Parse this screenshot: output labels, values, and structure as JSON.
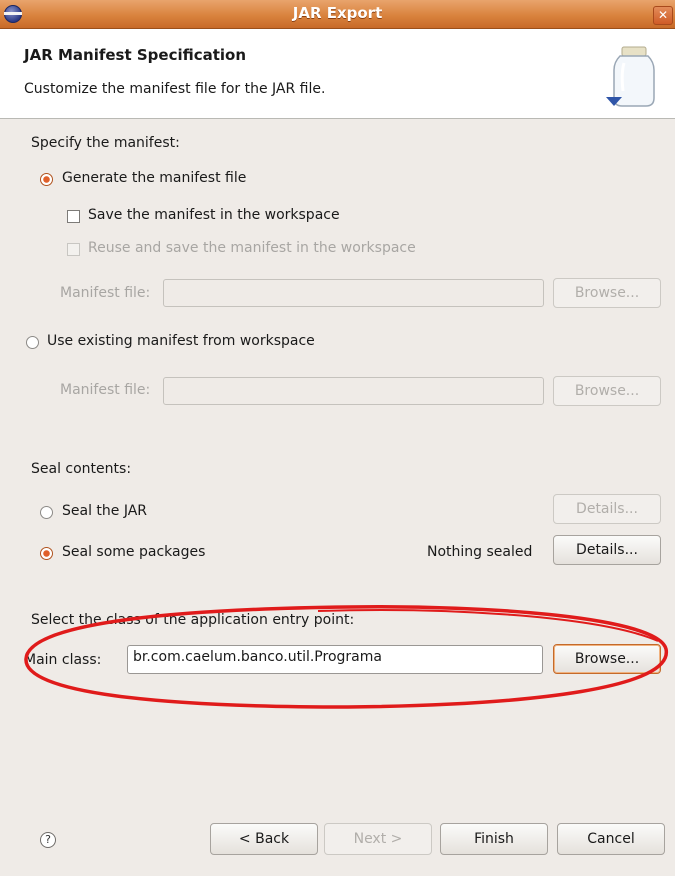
{
  "window": {
    "title": "JAR Export"
  },
  "banner": {
    "title": "JAR Manifest Specification",
    "description": "Customize the manifest file for the JAR file."
  },
  "manifest": {
    "section_label": "Specify the manifest:",
    "generate_radio": "Generate the manifest file",
    "save_checkbox": "Save the manifest in the workspace",
    "reuse_checkbox": "Reuse and save the manifest in the workspace",
    "file_label_1": "Manifest file:",
    "browse_1": "Browse...",
    "existing_radio": "Use existing manifest from workspace",
    "file_label_2": "Manifest file:",
    "browse_2": "Browse..."
  },
  "seal": {
    "section_label": "Seal contents:",
    "seal_jar_radio": "Seal the JAR",
    "details_1": "Details...",
    "seal_packages_radio": "Seal some packages",
    "status": "Nothing sealed",
    "details_2": "Details..."
  },
  "entry": {
    "section_label": "Select the class of the application entry point:",
    "main_class_label": "Main class:",
    "main_class_value": "br.com.caelum.banco.util.Programa",
    "browse": "Browse..."
  },
  "footer": {
    "help_icon": "?",
    "back": "< Back",
    "next": "Next >",
    "finish": "Finish",
    "cancel": "Cancel"
  },
  "colors": {
    "title_bar": "#d9833e",
    "annotation_oval": "#e01b1b",
    "radio_selected": "#e0602a"
  }
}
